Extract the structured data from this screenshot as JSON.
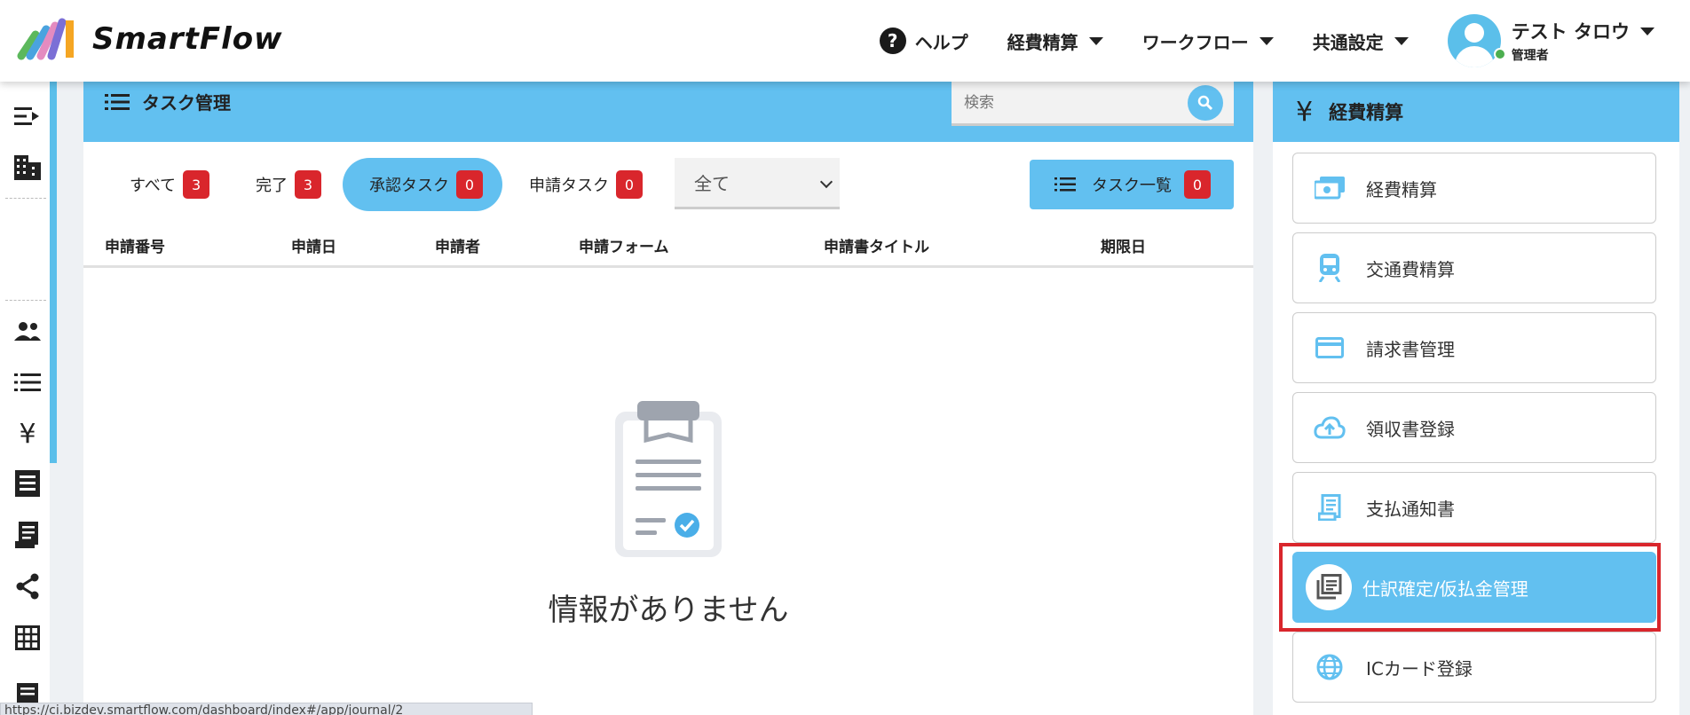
{
  "header": {
    "logo_text": "SmartFlow",
    "nav": {
      "help": "ヘルプ",
      "expense": "経費精算",
      "workflow": "ワークフロー",
      "common_settings": "共通設定"
    },
    "user": {
      "name": "テスト タロウ",
      "role": "管理者"
    }
  },
  "task_panel": {
    "title": "タスク管理",
    "search_placeholder": "検索",
    "tabs": [
      {
        "label": "すべて",
        "count": "3"
      },
      {
        "label": "完了",
        "count": "3"
      },
      {
        "label": "承認タスク",
        "count": "0",
        "active": true
      },
      {
        "label": "申請タスク",
        "count": "0"
      }
    ],
    "filter_value": "全て",
    "task_list_button": {
      "label": "タスク一覧",
      "count": "0"
    },
    "columns": [
      "申請番号",
      "申請日",
      "申請者",
      "申請フォーム",
      "申請書タイトル",
      "期限日"
    ],
    "empty_message": "情報がありません"
  },
  "right_panel": {
    "title": "経費精算",
    "items": [
      {
        "label": "経費精算",
        "icon": "money-icon"
      },
      {
        "label": "交通費精算",
        "icon": "train-icon"
      },
      {
        "label": "請求書管理",
        "icon": "credit-card-icon"
      },
      {
        "label": "領収書登録",
        "icon": "cloud-upload-icon"
      },
      {
        "label": "支払通知書",
        "icon": "receipt-icon"
      },
      {
        "label": "仕訳確定/仮払金管理",
        "icon": "library-books-icon",
        "active": true
      },
      {
        "label": "ICカード登録",
        "icon": "globe-icon"
      }
    ]
  },
  "status_bar": {
    "url": "https://ci.bizdev.smartflow.com/dashboard/index#/app/journal/2"
  },
  "colors": {
    "accent": "#62c0f0",
    "badge": "#d9262c",
    "highlight": "#d9262c"
  }
}
